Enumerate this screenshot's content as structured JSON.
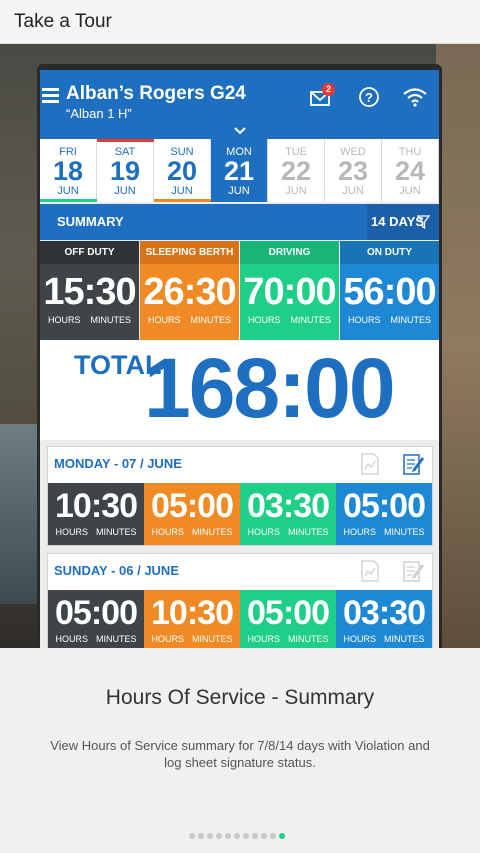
{
  "topbar": {
    "title": "Take a Tour"
  },
  "app": {
    "driver_name": "Alban’s Rogers G24",
    "driver_sub": "“Alban 1 H”",
    "mail_badge": "2"
  },
  "days": [
    {
      "dow": "FRI",
      "num": "18",
      "mon": "JUN",
      "state": "past",
      "bar": "#1fcf88"
    },
    {
      "dow": "SAT",
      "num": "19",
      "mon": "JUN",
      "state": "past",
      "bar": "#e53935"
    },
    {
      "dow": "SUN",
      "num": "20",
      "mon": "JUN",
      "state": "past",
      "bar": "#f08a24"
    },
    {
      "dow": "MON",
      "num": "21",
      "mon": "JUN",
      "state": "selected",
      "bar": ""
    },
    {
      "dow": "TUE",
      "num": "22",
      "mon": "JUN",
      "state": "future",
      "bar": ""
    },
    {
      "dow": "WED",
      "num": "23",
      "mon": "JUN",
      "state": "future",
      "bar": ""
    },
    {
      "dow": "THU",
      "num": "24",
      "mon": "JUN",
      "state": "future",
      "bar": ""
    }
  ],
  "summary": {
    "label": "SUMMARY",
    "range": "14 DAYS"
  },
  "totals": [
    {
      "status": "OFF DUTY",
      "value": "15:30",
      "hours": "HOURS",
      "minutes": "MINUTES"
    },
    {
      "status": "SLEEPING BERTH",
      "value": "26:30",
      "hours": "HOURS",
      "minutes": "MINUTES"
    },
    {
      "status": "DRIVING",
      "value": "70:00",
      "hours": "HOURS",
      "minutes": "MINUTES"
    },
    {
      "status": "ON DUTY",
      "value": "56:00",
      "hours": "HOURS",
      "minutes": "MINUTES"
    }
  ],
  "grand_total": {
    "label": "TOTAL",
    "value": "168:00"
  },
  "day_cards": [
    {
      "title": "MONDAY - 07 / JUNE",
      "cells": [
        {
          "value": "10:30",
          "hours": "HOURS",
          "minutes": "MINUTES"
        },
        {
          "value": "05:00",
          "hours": "HOURS",
          "minutes": "MINUTES"
        },
        {
          "value": "03:30",
          "hours": "HOURS",
          "minutes": "MINUTES"
        },
        {
          "value": "05:00",
          "hours": "HOURS",
          "minutes": "MINUTES"
        }
      ]
    },
    {
      "title": "SUNDAY - 06 / JUNE",
      "cells": [
        {
          "value": "05:00",
          "hours": "HOURS",
          "minutes": "MINUTES"
        },
        {
          "value": "10:30",
          "hours": "HOURS",
          "minutes": "MINUTES"
        },
        {
          "value": "05:00",
          "hours": "HOURS",
          "minutes": "MINUTES"
        },
        {
          "value": "03:30",
          "hours": "HOURS",
          "minutes": "MINUTES"
        }
      ]
    }
  ],
  "tour": {
    "title": "Hours Of Service - Summary",
    "description": "View Hours of Service summary for 7/8/14 days with Violation and log sheet signature status.",
    "page_count": 11,
    "active_page": 10
  },
  "colors": {
    "primary_blue": "#1f6fc0",
    "off_duty": "#3e4448",
    "sleeping_berth": "#f08a24",
    "driving": "#1fcf88",
    "on_duty": "#1f88d4"
  },
  "icons": [
    "menu-icon",
    "mail-icon",
    "help-icon",
    "wifi-icon",
    "chevron-down-icon",
    "filter-icon",
    "violation-chart-icon",
    "sign-log-icon"
  ]
}
